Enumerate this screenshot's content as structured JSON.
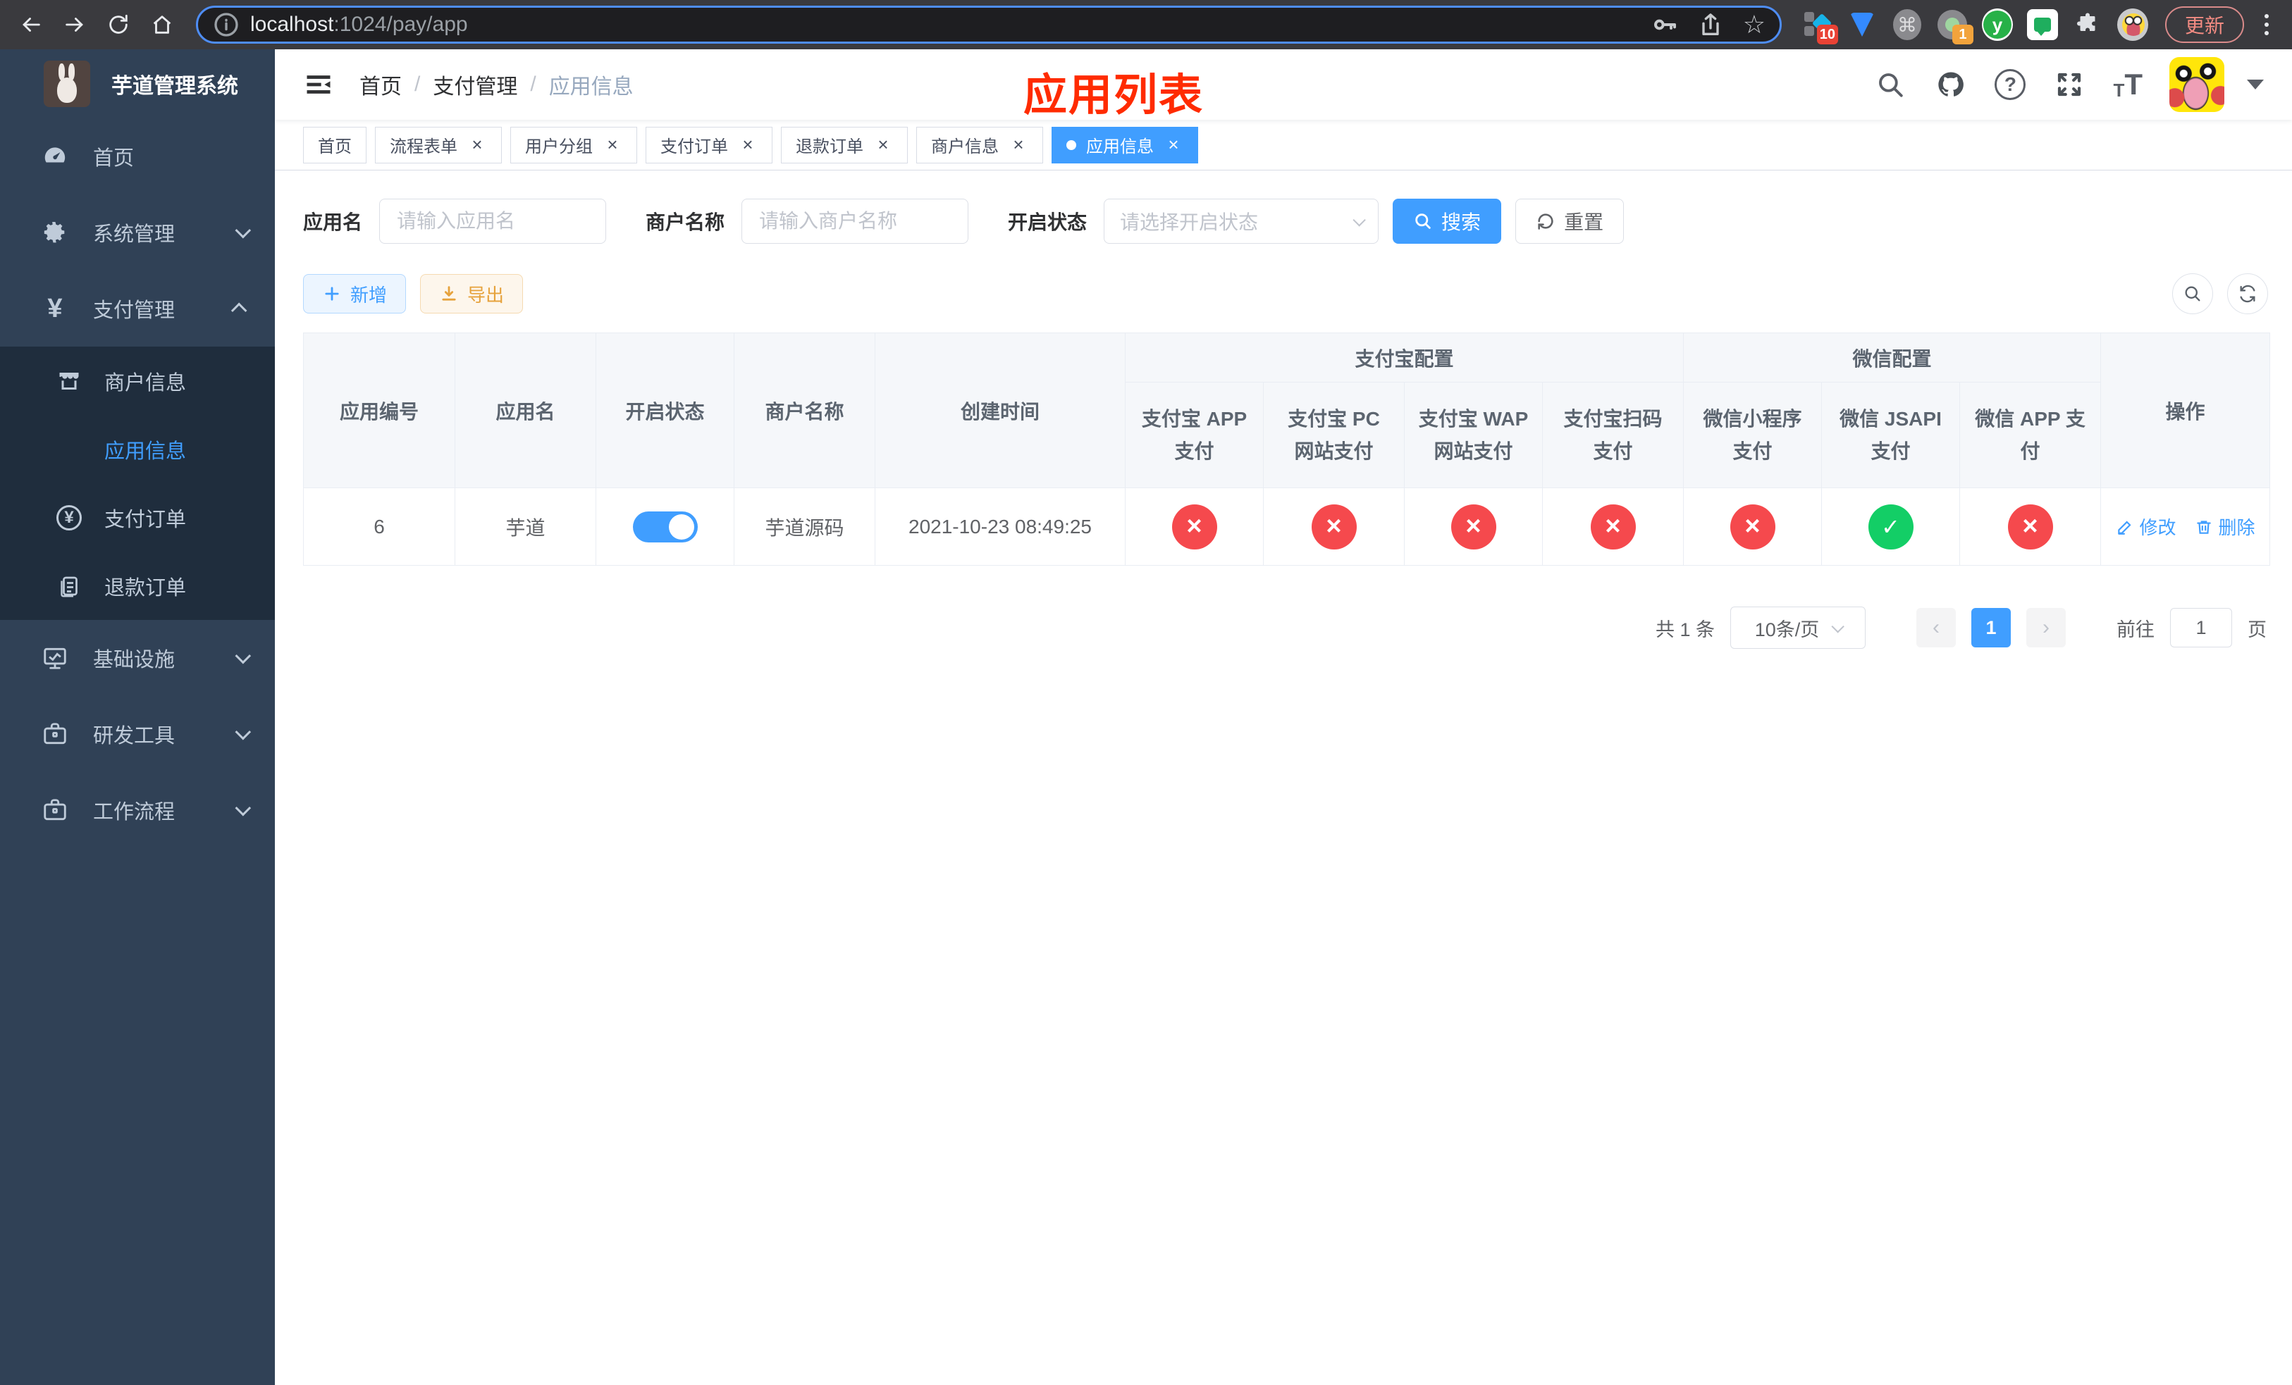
{
  "browser": {
    "url": {
      "host": "localhost",
      "path": ":1024/pay/app"
    },
    "update_label": "更新",
    "badges": {
      "ext1": "10",
      "ext4": "1"
    },
    "ext_y_letter": "y",
    "cmd_glyph": "⌘"
  },
  "sidebar": {
    "title": "芋道管理系统",
    "menu": [
      {
        "label": "首页"
      },
      {
        "label": "系统管理"
      },
      {
        "label": "支付管理"
      },
      {
        "label": "基础设施"
      },
      {
        "label": "研发工具"
      },
      {
        "label": "工作流程"
      }
    ],
    "submenu": [
      {
        "label": "商户信息"
      },
      {
        "label": "应用信息"
      },
      {
        "label": "支付订单"
      },
      {
        "label": "退款订单"
      }
    ]
  },
  "navbar": {
    "breadcrumb": [
      "首页",
      "支付管理",
      "应用信息"
    ],
    "annotation": "应用列表"
  },
  "tabs": [
    {
      "label": "首页"
    },
    {
      "label": "流程表单"
    },
    {
      "label": "用户分组"
    },
    {
      "label": "支付订单"
    },
    {
      "label": "退款订单"
    },
    {
      "label": "商户信息"
    },
    {
      "label": "应用信息"
    }
  ],
  "filters": {
    "app_name": {
      "label": "应用名",
      "placeholder": "请输入应用名",
      "value": ""
    },
    "merchant": {
      "label": "商户名称",
      "placeholder": "请输入商户名称",
      "value": ""
    },
    "status": {
      "label": "开启状态",
      "placeholder": "请选择开启状态"
    },
    "search_label": "搜索",
    "reset_label": "重置"
  },
  "toolbar": {
    "add_label": "新增",
    "export_label": "导出"
  },
  "table": {
    "headers": {
      "app_id": "应用编号",
      "app_name": "应用名",
      "status": "开启状态",
      "merchant": "商户名称",
      "created": "创建时间",
      "alipay_group": "支付宝配置",
      "wechat_group": "微信配置",
      "actions": "操作",
      "alipay": [
        "支付宝 APP 支付",
        "支付宝 PC 网站支付",
        "支付宝 WAP 网站支付",
        "支付宝扫码支付"
      ],
      "wechat": [
        "微信小程序支付",
        "微信 JSAPI 支付",
        "微信 APP 支付"
      ]
    },
    "rows": [
      {
        "app_id": "6",
        "app_name": "芋道",
        "enabled": "on",
        "merchant": "芋道源码",
        "created": "2021-10-23 08:49:25",
        "channels": [
          "no",
          "no",
          "no",
          "no",
          "no",
          "ok",
          "no"
        ],
        "edit_label": "修改",
        "delete_label": "删除"
      }
    ]
  },
  "pagination": {
    "total": "共 1 条",
    "page_size": "10条/页",
    "current": "1",
    "goto_label": "前往",
    "goto_value": "1",
    "page_suffix": "页"
  },
  "colors": {
    "primary": "#409eff",
    "danger": "#f5494d",
    "success": "#13ce66",
    "warning": "#e6a23c",
    "annotation": "#ff2b00"
  }
}
